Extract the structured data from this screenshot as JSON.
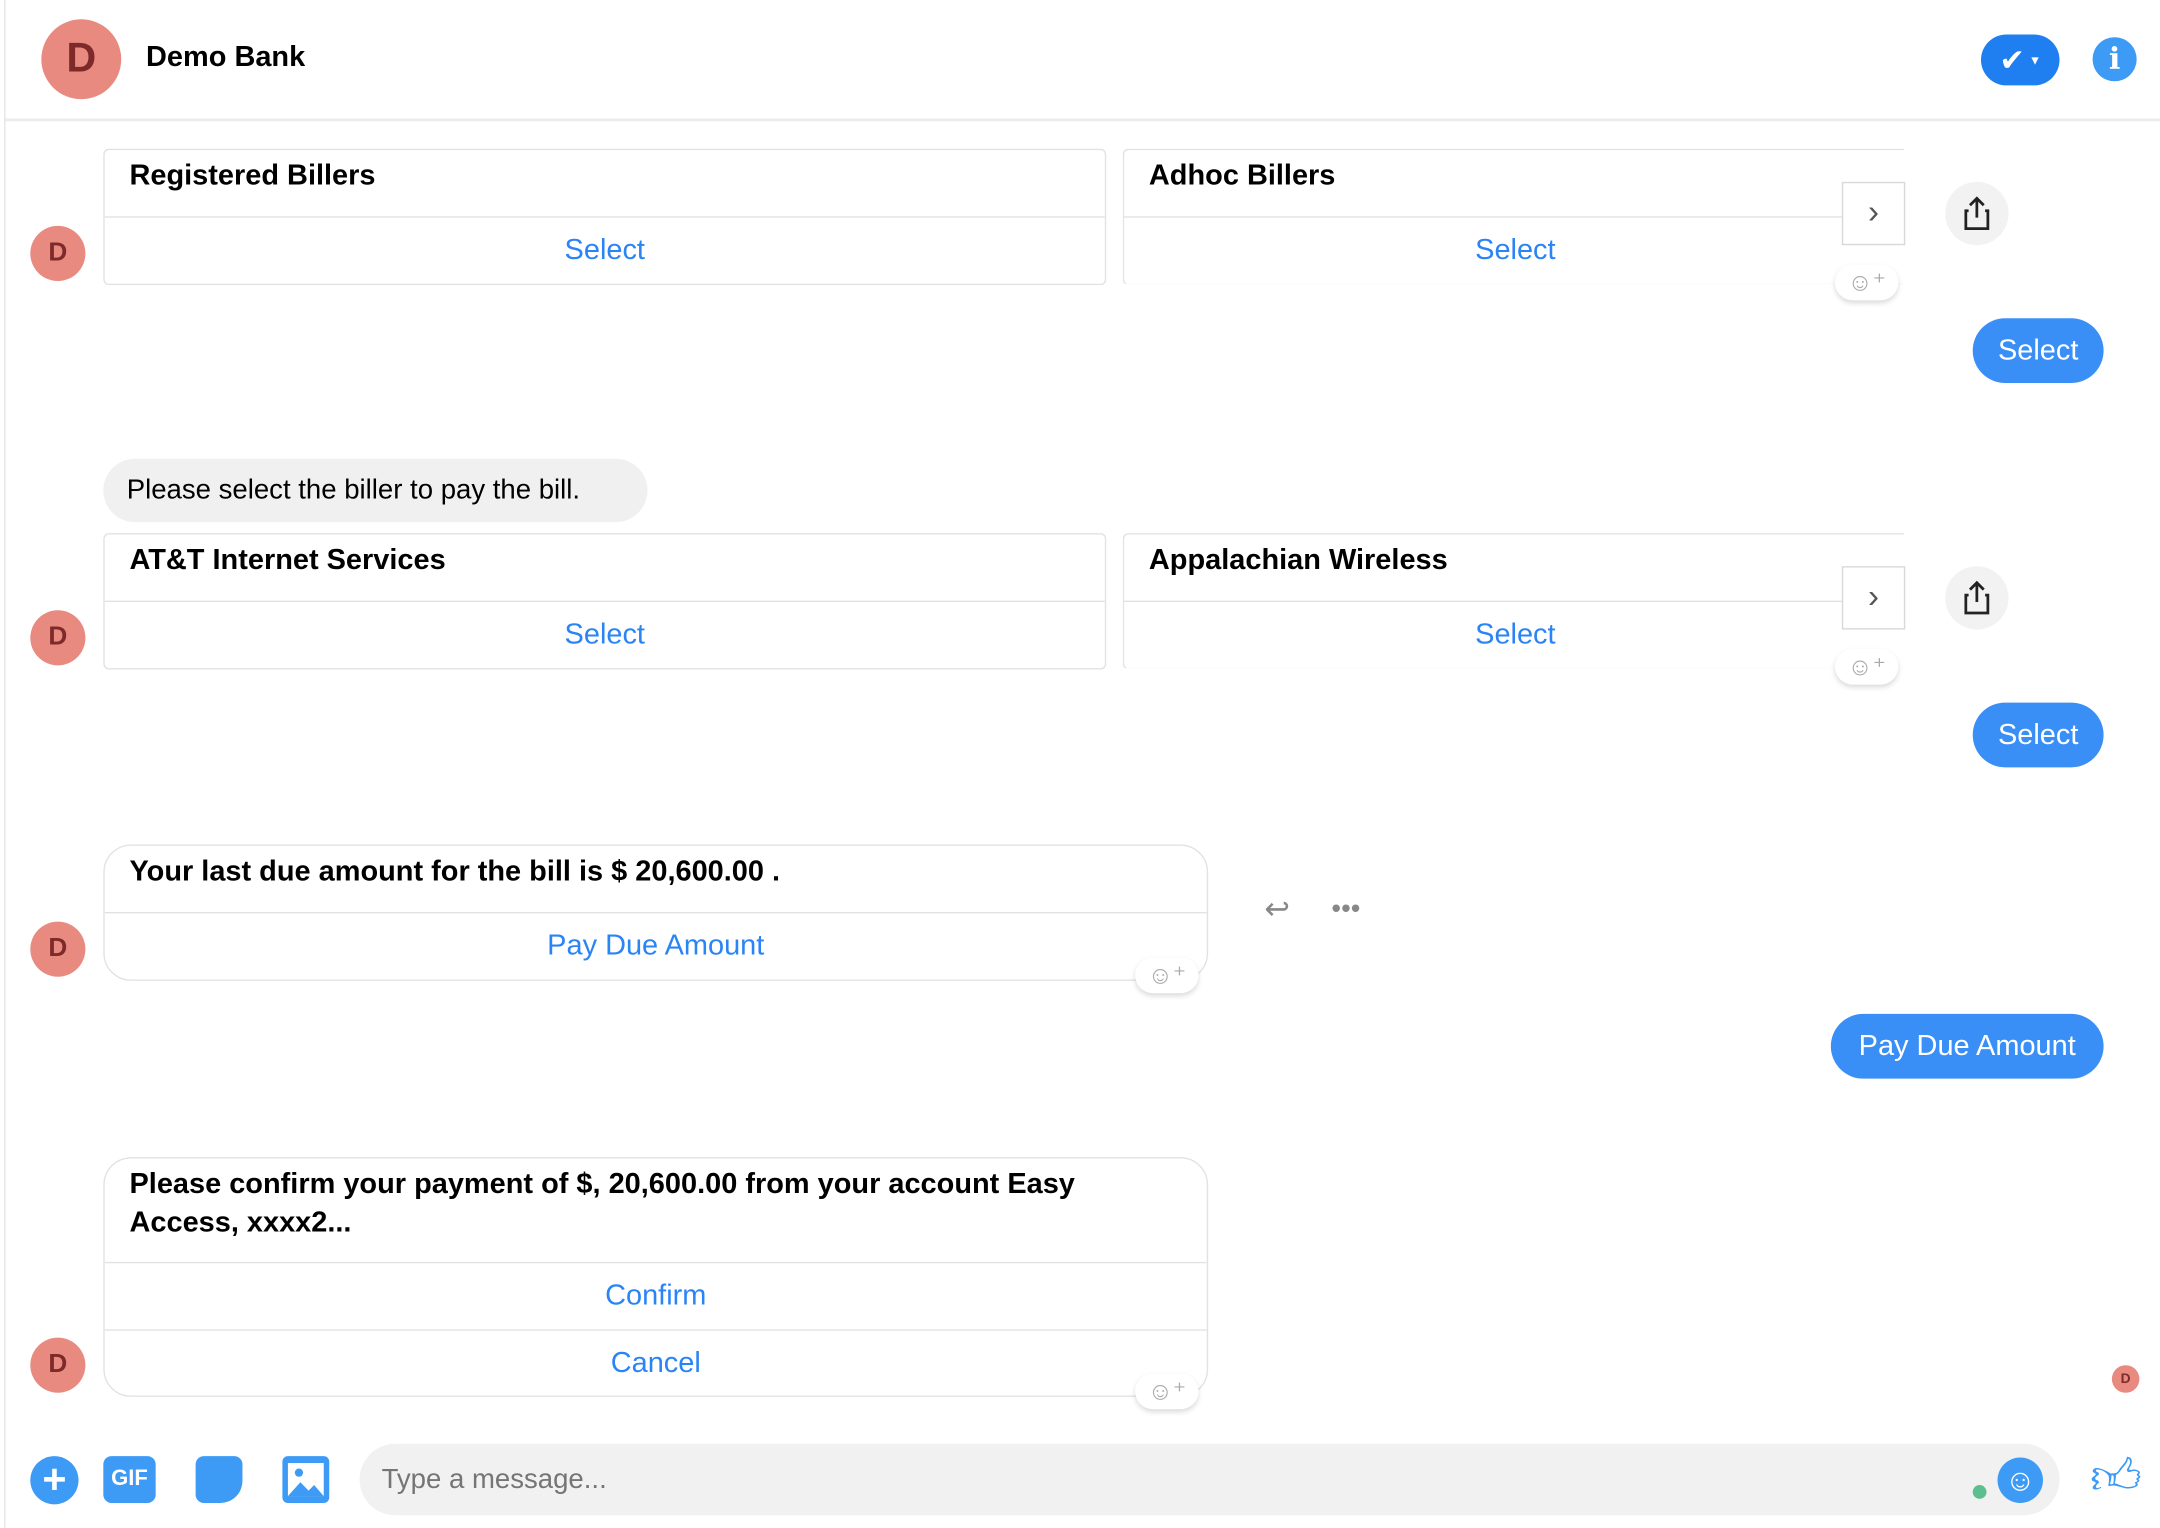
{
  "header": {
    "avatar_letter": "D",
    "title": "Demo Bank",
    "icons": [
      "check-dropdown-icon",
      "info-icon"
    ]
  },
  "colors": {
    "accent": "#2a84f5",
    "bubble": "#3a8ff7",
    "avatar": "#e88a80"
  },
  "messages": {
    "carousel1": {
      "cards": [
        {
          "title": "Registered Billers",
          "button": "Select"
        },
        {
          "title": "Adhoc Billers",
          "button": "Select"
        }
      ]
    },
    "reply1": "Select",
    "prompt": "Please select the biller to pay the bill.",
    "carousel2": {
      "cards": [
        {
          "title": "AT&T Internet Services",
          "button": "Select"
        },
        {
          "title": "Appalachian Wireless",
          "button": "Select"
        }
      ]
    },
    "reply2": "Select",
    "due": {
      "title": "Your last due amount for the bill is $ 20,600.00 .",
      "button": "Pay Due Amount"
    },
    "reply3": "Pay Due Amount",
    "confirm": {
      "title": "Please confirm your payment of $, 20,600.00 from your account Easy Access, xxxx2...",
      "buttons": [
        "Confirm",
        "Cancel"
      ]
    },
    "avatar_letter": "D"
  },
  "composer": {
    "placeholder": "Type a message...",
    "icons": [
      "plus-icon",
      "gif-icon",
      "sticker-icon",
      "image-icon",
      "emoji-icon",
      "thumbs-up-icon"
    ],
    "gif_label": "GIF"
  }
}
